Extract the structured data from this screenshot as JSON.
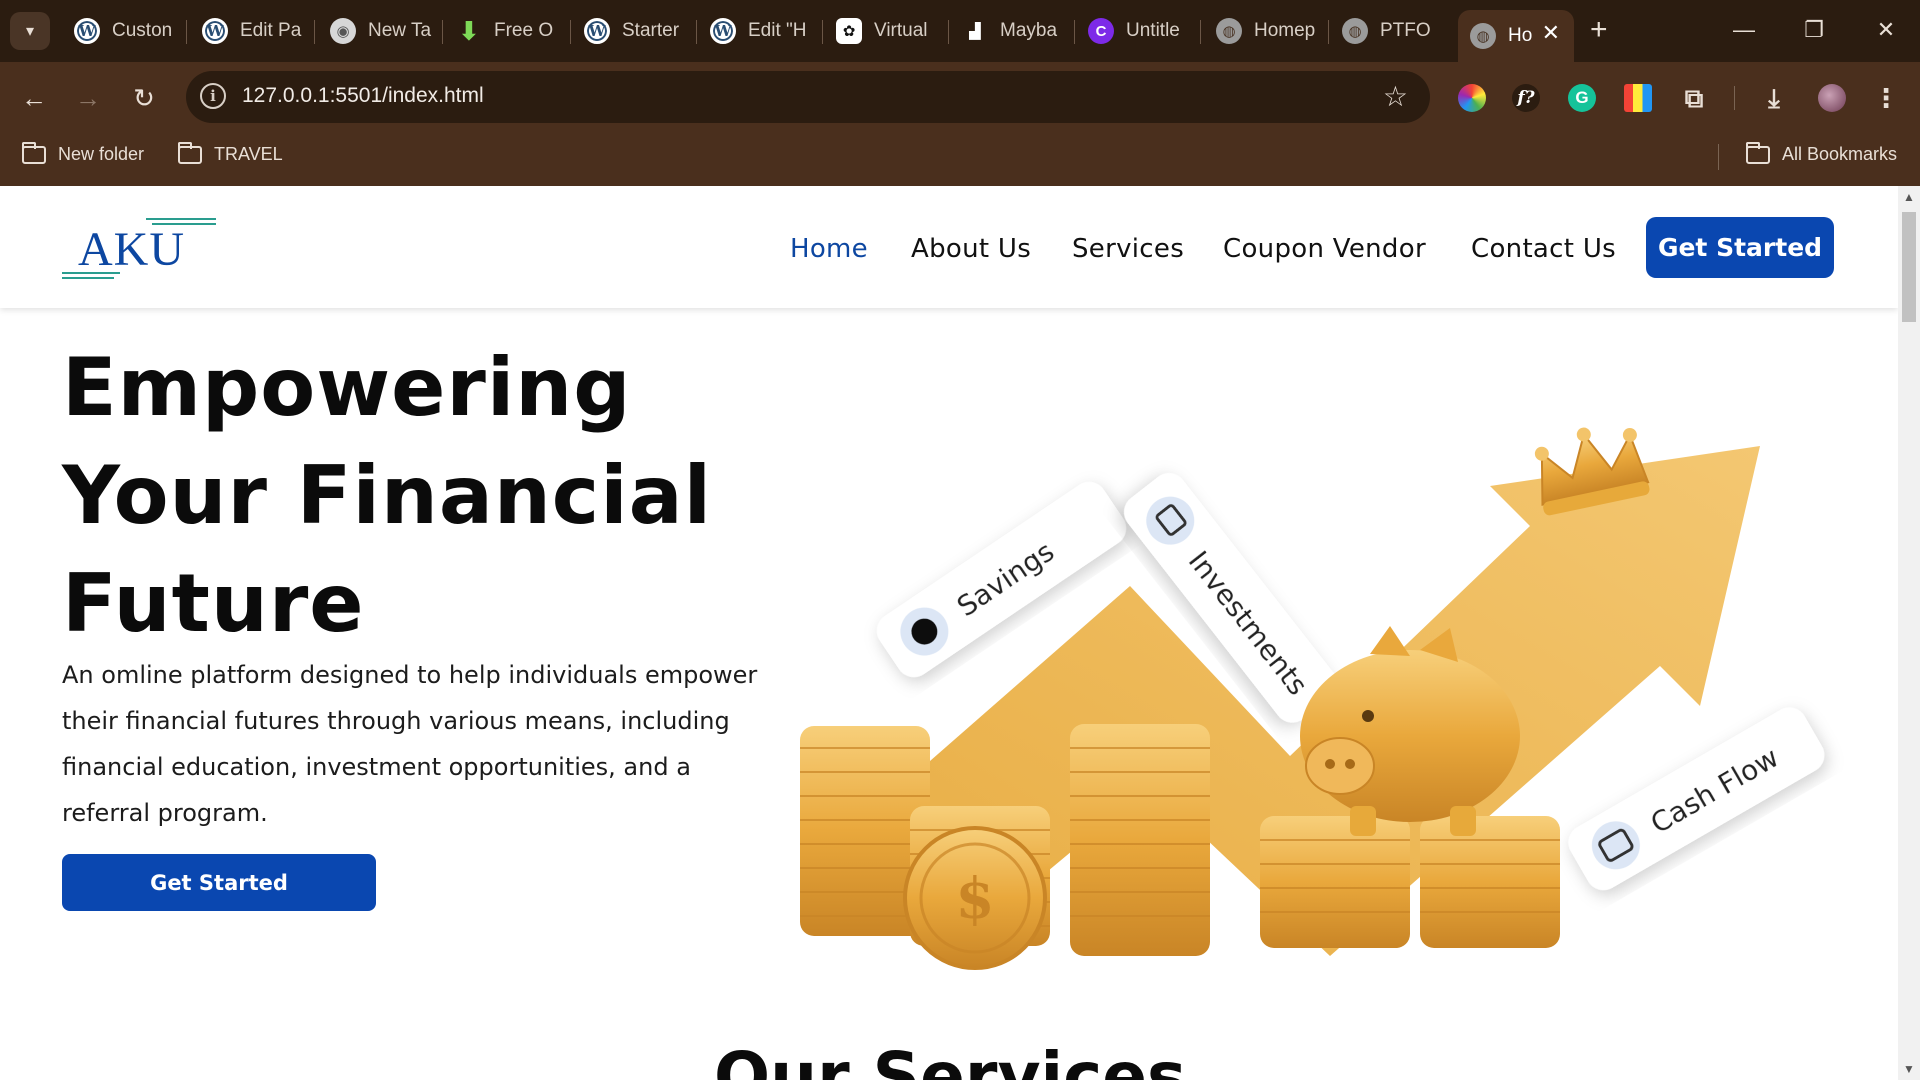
{
  "browser": {
    "tabs": [
      {
        "label": "Custon",
        "icon": "wordpress-icon"
      },
      {
        "label": "Edit Pa",
        "icon": "wordpress-icon"
      },
      {
        "label": "New Ta",
        "icon": "chrome-icon"
      },
      {
        "label": "Free O",
        "icon": "download-arrow-icon"
      },
      {
        "label": "Starter",
        "icon": "wordpress-icon"
      },
      {
        "label": "Edit \"H",
        "icon": "wordpress-icon"
      },
      {
        "label": "Virtual",
        "icon": "chatgpt-icon"
      },
      {
        "label": "Mayba",
        "icon": "maybank-icon"
      },
      {
        "label": "Untitle",
        "icon": "canva-icon"
      },
      {
        "label": "Homep",
        "icon": "globe-icon"
      },
      {
        "label": "PTFO",
        "icon": "globe-icon"
      }
    ],
    "active_tab": {
      "label": "Ho",
      "icon": "globe-icon"
    },
    "url": "127.0.0.1:5501/index.html",
    "bookmarks": [
      {
        "label": "New folder"
      },
      {
        "label": "TRAVEL"
      }
    ],
    "all_bookmarks": "All Bookmarks"
  },
  "site": {
    "logo": "AKU",
    "nav": [
      {
        "label": "Home",
        "active": true
      },
      {
        "label": "About Us"
      },
      {
        "label": "Services"
      },
      {
        "label": "Coupon Vendor"
      },
      {
        "label": "Contact Us"
      }
    ],
    "nav_cta": "Get Started",
    "hero": {
      "title_line1": "Empowering",
      "title_line2": "Your Financial",
      "title_line3": "Future",
      "description": "An omline platform designed to help individuals empower their financial futures through various means, including financial education, investment opportunities, and a referral program.",
      "cta": "Get Started"
    },
    "hero_image_labels": {
      "savings": "Savings",
      "investments": "Investments",
      "cash_flow": "Cash Flow"
    },
    "services_title": "Our Services"
  },
  "colors": {
    "brand_blue": "#0a47b0",
    "browser_frame": "#4a2f1d",
    "tab_strip": "#2b1c10",
    "gold": "#e7a93a"
  }
}
